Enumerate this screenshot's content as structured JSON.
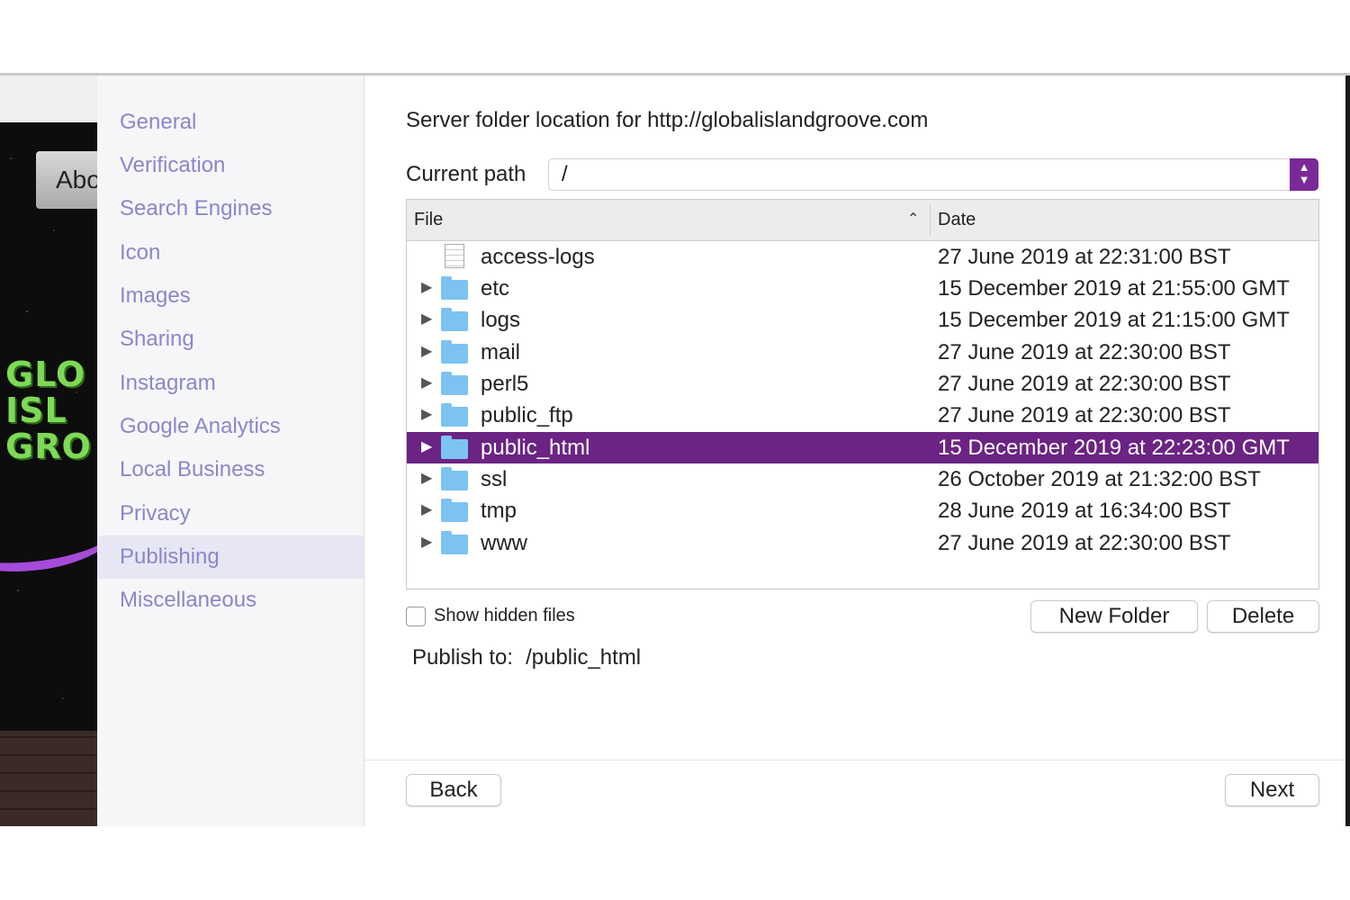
{
  "background_app": {
    "about_tab": "Abo",
    "logo_lines": [
      "GLO",
      "ISL",
      "GRO"
    ]
  },
  "sidebar": {
    "items": [
      {
        "label": "General"
      },
      {
        "label": "Verification"
      },
      {
        "label": "Search Engines"
      },
      {
        "label": "Icon"
      },
      {
        "label": "Images"
      },
      {
        "label": "Sharing"
      },
      {
        "label": "Instagram"
      },
      {
        "label": "Google Analytics"
      },
      {
        "label": "Local Business"
      },
      {
        "label": "Privacy"
      },
      {
        "label": "Publishing",
        "active": true
      },
      {
        "label": "Miscellaneous"
      }
    ]
  },
  "main": {
    "title": "Server folder location for http://globalislandgroove.com",
    "current_path_label": "Current path",
    "current_path_value": "/",
    "table": {
      "columns": [
        "File",
        "Date"
      ],
      "rows": [
        {
          "name": "access-logs",
          "date": "27 June 2019 at 22:31:00 BST",
          "type": "file"
        },
        {
          "name": "etc",
          "date": "15 December 2019 at 21:55:00 GMT",
          "type": "folder"
        },
        {
          "name": "logs",
          "date": "15 December 2019 at 21:15:00 GMT",
          "type": "folder"
        },
        {
          "name": "mail",
          "date": "27 June 2019 at 22:30:00 BST",
          "type": "folder"
        },
        {
          "name": "perl5",
          "date": "27 June 2019 at 22:30:00 BST",
          "type": "folder"
        },
        {
          "name": "public_ftp",
          "date": "27 June 2019 at 22:30:00 BST",
          "type": "folder"
        },
        {
          "name": "public_html",
          "date": "15 December 2019 at 22:23:00 GMT",
          "type": "folder",
          "selected": true
        },
        {
          "name": "ssl",
          "date": "26 October 2019 at 21:32:00 BST",
          "type": "folder"
        },
        {
          "name": "tmp",
          "date": "28 June 2019 at 16:34:00 BST",
          "type": "folder"
        },
        {
          "name": "www",
          "date": "27 June 2019 at 22:30:00 BST",
          "type": "folder"
        }
      ]
    },
    "show_hidden_label": "Show hidden files",
    "show_hidden_checked": false,
    "new_folder_label": "New Folder",
    "delete_label": "Delete",
    "publish_to_label": "Publish to:",
    "publish_to_value": "/public_html",
    "back_label": "Back",
    "next_label": "Next"
  },
  "colors": {
    "accent": "#6b2483",
    "sidebar_text": "#8a87c9",
    "folder": "#7cc3f2"
  }
}
